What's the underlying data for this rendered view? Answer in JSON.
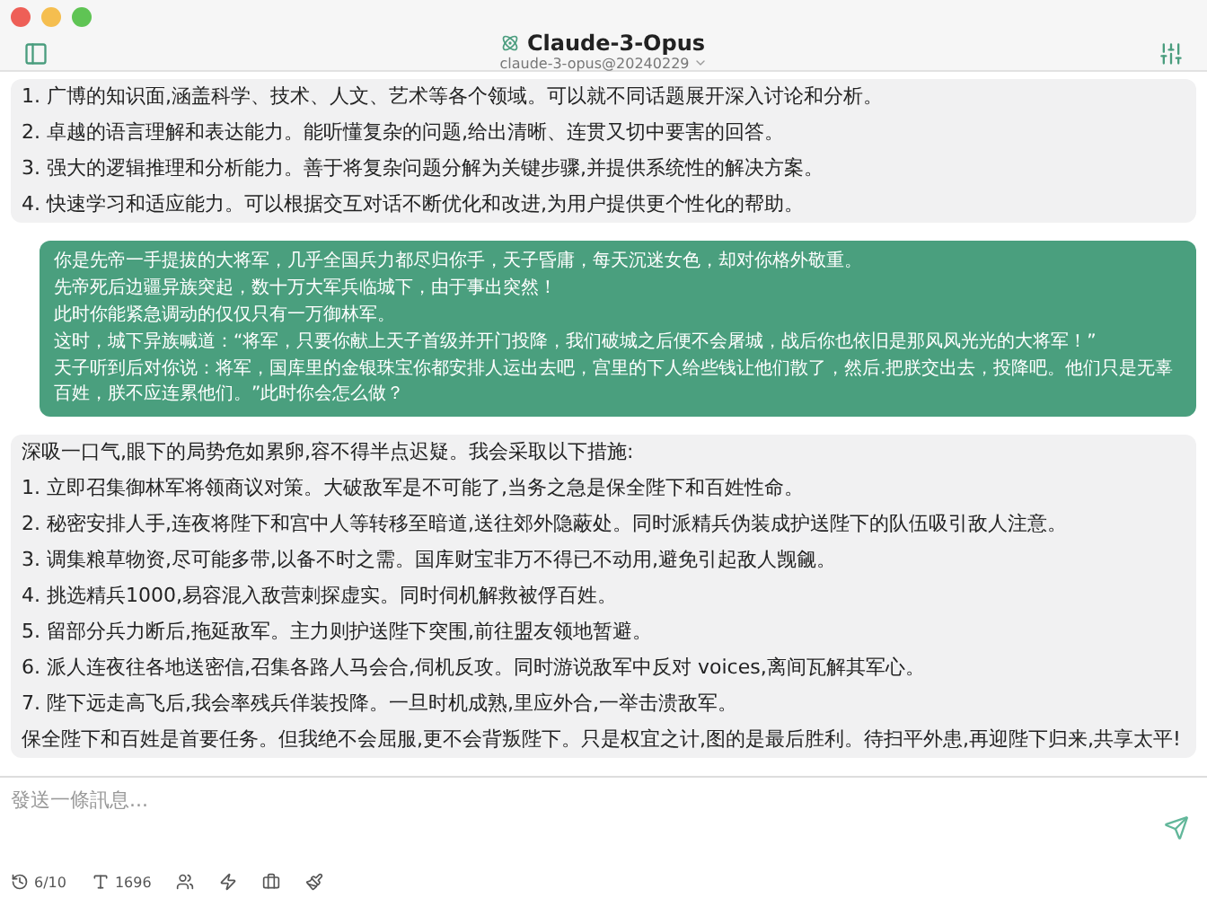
{
  "window": {
    "title": "Claude-3-Opus",
    "subtitle": "claude-3-opus@20240229"
  },
  "messages": [
    {
      "kind": "assistant",
      "paragraphs": [
        "1. 广博的知识面,涵盖科学、技术、人文、艺术等各个领域。可以就不同话题展开深入讨论和分析。",
        "2. 卓越的语言理解和表达能力。能听懂复杂的问题,给出清晰、连贯又切中要害的回答。",
        "3. 强大的逻辑推理和分析能力。善于将复杂问题分解为关键步骤,并提供系统性的解决方案。",
        "4. 快速学习和适应能力。可以根据交互对话不断优化和改进,为用户提供更个性化的帮助。"
      ]
    },
    {
      "kind": "user",
      "paragraphs": [
        "你是先帝一手提拔的大将军，几乎全国兵力都尽归你手，天子昏庸，每天沉迷女色，却对你格外敬重。",
        "先帝死后边疆异族突起，数十万大军兵临城下，由于事出突然！",
        "此时你能紧急调动的仅仅只有一万御林军。",
        "这时，城下异族喊道：“将军，只要你献上天子首级并开门投降，我们破城之后便不会屠城，战后你也依旧是那风风光光的大将军！”",
        "天子听到后对你说：将军，国库里的金银珠宝你都安排人运出去吧，宫里的下人给些钱让他们散了，然后.把朕交出去，投降吧。他们只是无辜百姓，朕不应连累他们。”此时你会怎么做？"
      ]
    },
    {
      "kind": "assistant",
      "paragraphs": [
        "深吸一口气,眼下的局势危如累卵,容不得半点迟疑。我会采取以下措施:",
        "1. 立即召集御林军将领商议对策。大破敌军是不可能了,当务之急是保全陛下和百姓性命。",
        "2. 秘密安排人手,连夜将陛下和宫中人等转移至暗道,送往郊外隐蔽处。同时派精兵伪装成护送陛下的队伍吸引敌人注意。",
        "3. 调集粮草物资,尽可能多带,以备不时之需。国库财宝非万不得已不动用,避免引起敌人觊觎。",
        "4. 挑选精兵1000,易容混入敌营刺探虚实。同时伺机解救被俘百姓。",
        "5. 留部分兵力断后,拖延敌军。主力则护送陛下突围,前往盟友领地暂避。",
        "6. 派人连夜往各地送密信,召集各路人马会合,伺机反攻。同时游说敌军中反对 voices,离间瓦解其军心。",
        "7. 陛下远走高飞后,我会率残兵佯装投降。一旦时机成熟,里应外合,一举击溃敌军。",
        "保全陛下和百姓是首要任务。但我绝不会屈服,更不会背叛陛下。只是权宜之计,图的是最后胜利。待扫平外患,再迎陛下归来,共享太平!"
      ]
    }
  ],
  "composer": {
    "placeholder": "發送一條訊息..."
  },
  "toolbar": [
    {
      "kind": "history",
      "label": "6/10"
    },
    {
      "kind": "tokens",
      "label": "1696"
    },
    {
      "kind": "people"
    },
    {
      "kind": "bolt"
    },
    {
      "kind": "briefcase"
    },
    {
      "kind": "brush"
    }
  ]
}
